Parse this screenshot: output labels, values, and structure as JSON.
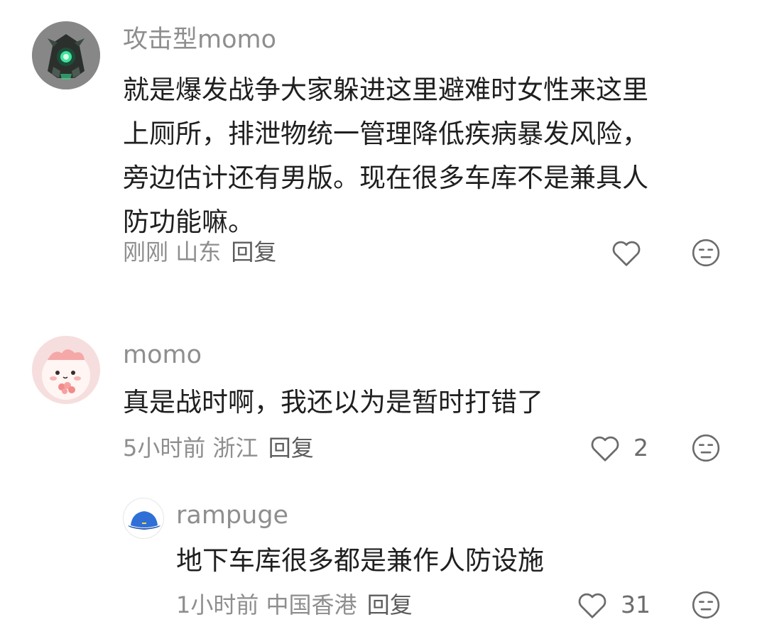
{
  "comments": [
    {
      "username": "攻击型momo",
      "lines": [
        "就是爆发战争大家躲进这里避难时女性来这里",
        "上厕所，排泄物统一管理降低疾病暴发风险，",
        "旁边估计还有男版。现在很多车库不是兼具人",
        "防功能嘛。"
      ],
      "time": "刚刚",
      "location": "山东",
      "reply": "回复",
      "likes": ""
    },
    {
      "username": "momo",
      "lines": [
        "真是战时啊，我还以为是暂时打错了"
      ],
      "time": "5小时前",
      "location": "浙江",
      "reply": "回复",
      "likes": "2"
    },
    {
      "username": "rampuge",
      "lines": [
        "地下车库很多都是兼作人防设施"
      ],
      "time": "1小时前",
      "location": "中国香港",
      "reply": "回复",
      "likes": "31"
    }
  ],
  "icons": {
    "like": "heart-outline-icon",
    "dislike": "unamused-face-icon"
  },
  "colors": {
    "text": "#1f1f1f",
    "meta": "#8e8e8e",
    "icon": "#6b6b6b"
  }
}
